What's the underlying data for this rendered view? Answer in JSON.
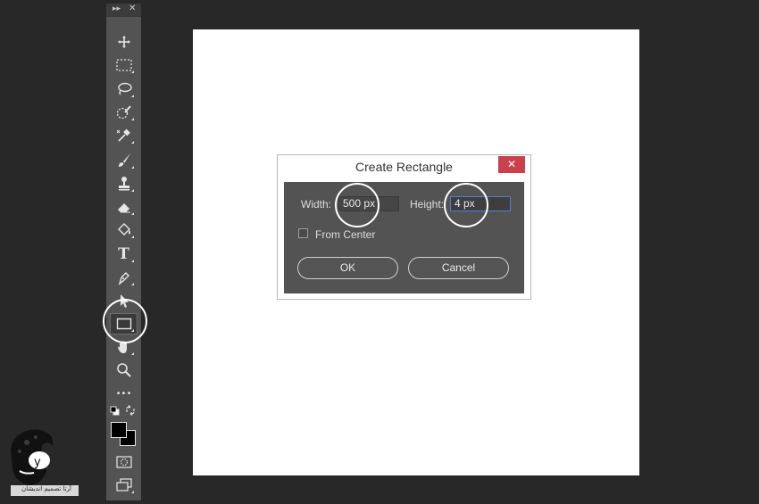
{
  "toolbar": {
    "collapse_glyph": "▸▸",
    "close_glyph": "✕",
    "tools": [
      {
        "name": "move-icon"
      },
      {
        "name": "rectangular-marquee-icon"
      },
      {
        "name": "lasso-icon"
      },
      {
        "name": "quick-selection-icon"
      },
      {
        "name": "eyedropper-icon"
      },
      {
        "name": "brush-icon"
      },
      {
        "name": "clone-stamp-icon"
      },
      {
        "name": "eraser-icon"
      },
      {
        "name": "paint-bucket-icon"
      },
      {
        "name": "type-icon",
        "glyph": "T"
      },
      {
        "name": "pen-icon"
      },
      {
        "name": "path-selection-icon"
      },
      {
        "name": "rectangle-tool-icon",
        "active": true
      },
      {
        "name": "hand-icon"
      },
      {
        "name": "zoom-icon"
      },
      {
        "name": "more-tools-icon",
        "glyph": "•••"
      },
      {
        "name": "default-colors-icon"
      },
      {
        "name": "swap-colors-icon"
      },
      {
        "name": "foreground-background-color-icon"
      },
      {
        "name": "quick-mask-icon"
      },
      {
        "name": "screen-mode-icon"
      }
    ],
    "foreground_color": "#000000",
    "background_color": "#000000"
  },
  "dialog": {
    "title": "Create Rectangle",
    "close_glyph": "✕",
    "width_label": "Width:",
    "width_value": "500 px",
    "height_label": "Height:",
    "height_value": "4 px",
    "from_center_label": "From Center",
    "from_center_checked": false,
    "ok_label": "OK",
    "cancel_label": "Cancel"
  },
  "colors": {
    "workspace": "#282828",
    "toolbar": "#535353",
    "dialog_body": "#535353",
    "close_button": "#c8414c",
    "focus_border": "#4d7fd6"
  },
  "watermark": {
    "caption": "آرتا تصمیم اندیشان"
  }
}
